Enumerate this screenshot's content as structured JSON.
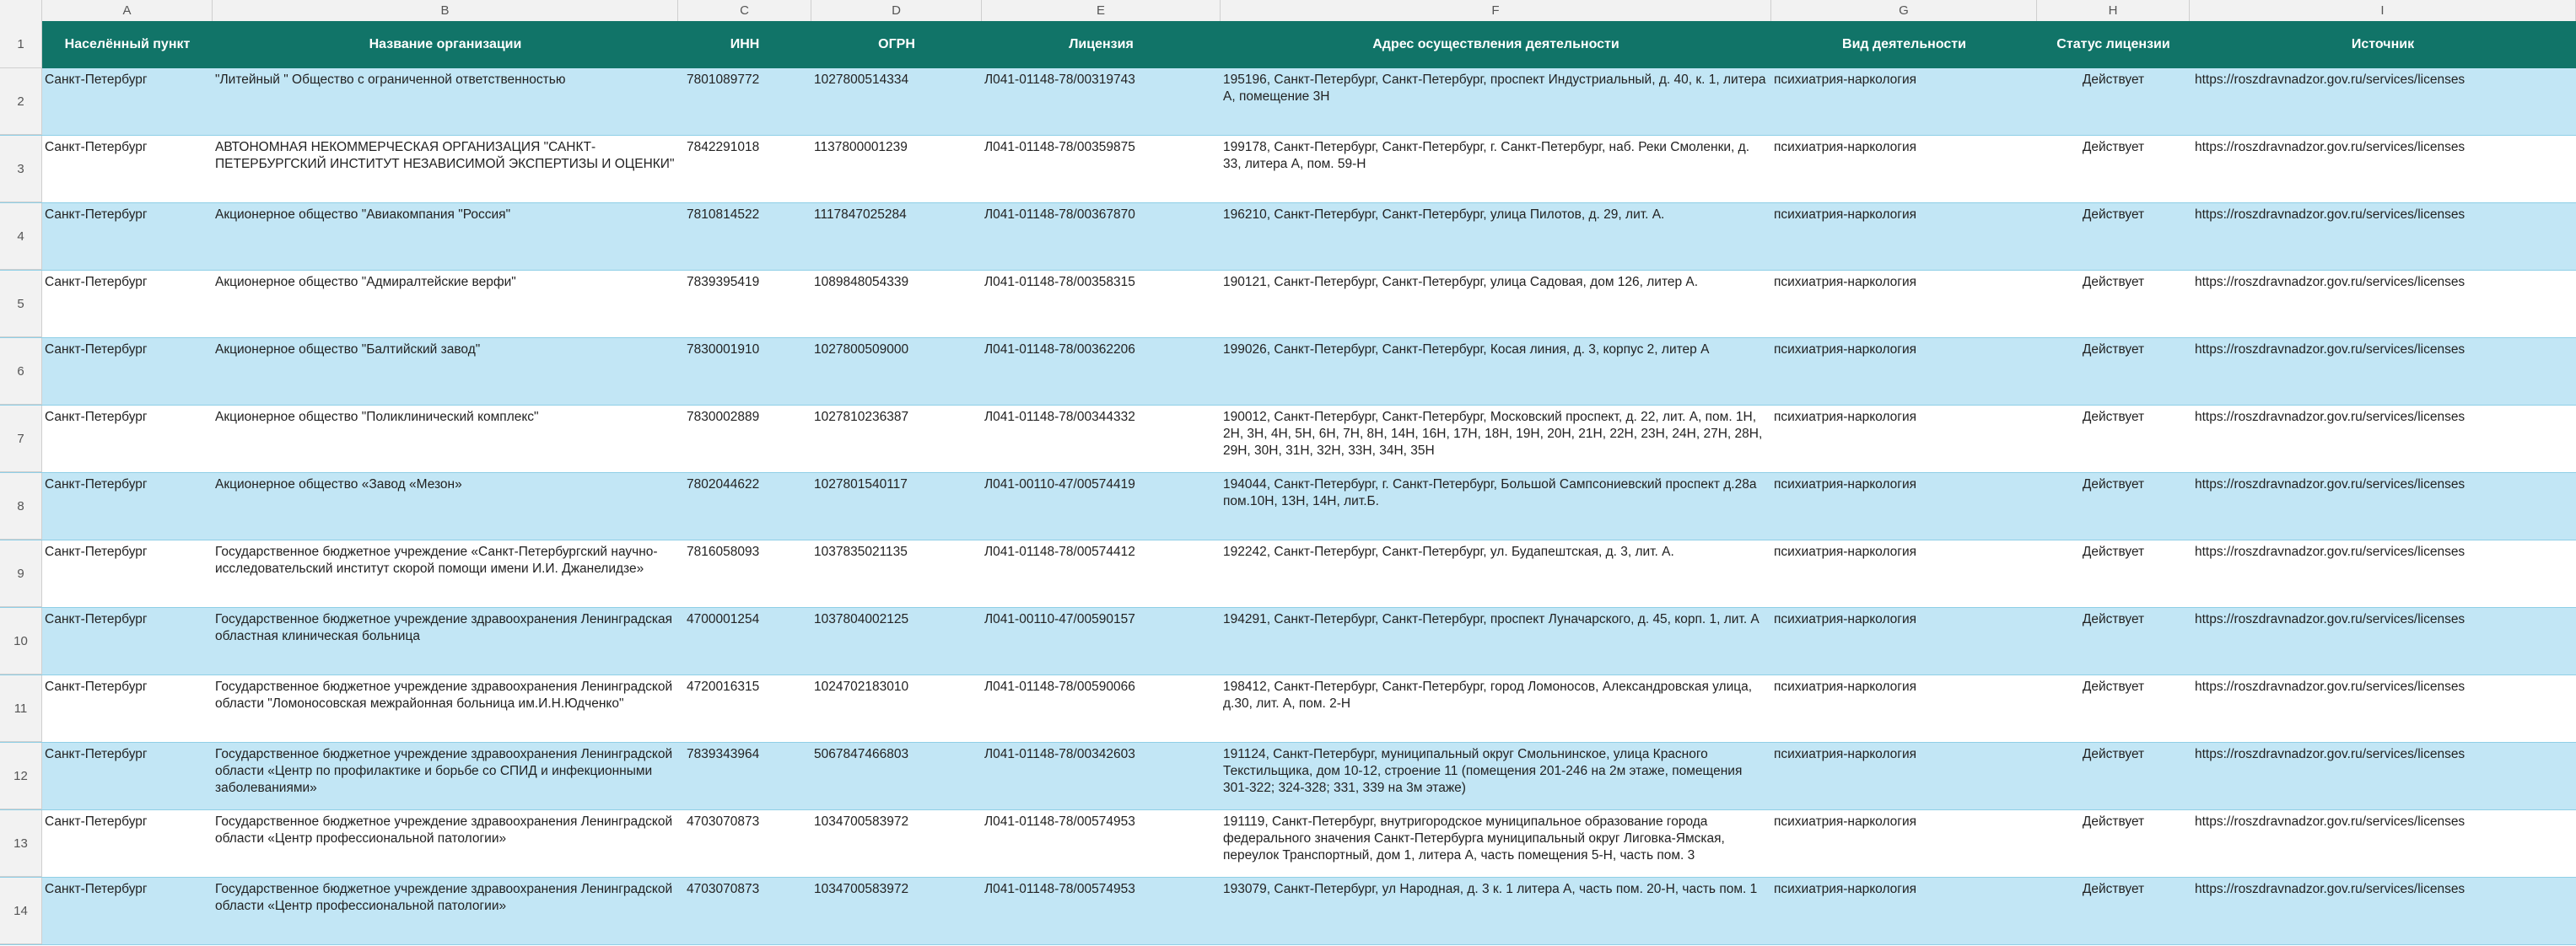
{
  "columns": [
    "A",
    "B",
    "C",
    "D",
    "E",
    "F",
    "G",
    "H",
    "I"
  ],
  "headers": [
    "Населённый пункт",
    "Название организации",
    "ИНН",
    "ОГРН",
    "Лицензия",
    "Адрес осуществления деятельности",
    "Вид деятельности",
    "Статус лицензии",
    "Источник"
  ],
  "row_numbers": [
    "1",
    "2",
    "3",
    "4",
    "5",
    "6",
    "7",
    "8",
    "9",
    "10",
    "11",
    "12",
    "13",
    "14"
  ],
  "rows": [
    [
      "Санкт-Петербург",
      "\"Литейный \" Общество с ограниченной ответственностью",
      "7801089772",
      "1027800514334",
      "Л041-01148-78/00319743",
      "195196, Санкт-Петербург, Санкт-Петербург, проспект Индустриальный, д. 40, к. 1, литера А, помещение 3Н",
      "психиатрия-наркология",
      "Действует",
      "https://roszdravnadzor.gov.ru/services/licenses"
    ],
    [
      "Санкт-Петербург",
      "АВТОНОМНАЯ НЕКОММЕРЧЕСКАЯ ОРГАНИЗАЦИЯ \"САНКТ-ПЕТЕРБУРГСКИЙ ИНСТИТУТ НЕЗАВИСИМОЙ ЭКСПЕРТИЗЫ И ОЦЕНКИ\"",
      "7842291018",
      "1137800001239",
      "Л041-01148-78/00359875",
      "199178, Санкт-Петербург, Санкт-Петербург, г. Санкт-Петербург, наб. Реки Смоленки, д. 33, литера А, пом. 59-Н",
      "психиатрия-наркология",
      "Действует",
      "https://roszdravnadzor.gov.ru/services/licenses"
    ],
    [
      "Санкт-Петербург",
      "Акционерное общество \"Авиакомпания \"Россия\"",
      "7810814522",
      "1117847025284",
      "Л041-01148-78/00367870",
      "196210, Санкт-Петербург, Санкт-Петербург, улица Пилотов, д. 29, лит. А.",
      "психиатрия-наркология",
      "Действует",
      "https://roszdravnadzor.gov.ru/services/licenses"
    ],
    [
      "Санкт-Петербург",
      "Акционерное общество \"Адмиралтейские верфи\"",
      "7839395419",
      "1089848054339",
      "Л041-01148-78/00358315",
      "190121, Санкт-Петербург, Санкт-Петербург, улица Садовая, дом 126, литер А.",
      "психиатрия-наркология",
      "Действует",
      "https://roszdravnadzor.gov.ru/services/licenses"
    ],
    [
      "Санкт-Петербург",
      "Акционерное общество \"Балтийский завод\"",
      "7830001910",
      "1027800509000",
      "Л041-01148-78/00362206",
      "199026, Санкт-Петербург, Санкт-Петербург, Косая линия, д. 3, корпус 2, литер А",
      "психиатрия-наркология",
      "Действует",
      "https://roszdravnadzor.gov.ru/services/licenses"
    ],
    [
      "Санкт-Петербург",
      "Акционерное общество \"Поликлинический комплекс\"",
      "7830002889",
      "1027810236387",
      "Л041-01148-78/00344332",
      "190012, Санкт-Петербург, Санкт-Петербург, Московский проспект, д. 22, лит. А, пом. 1Н, 2Н, 3Н, 4Н, 5Н, 6Н, 7Н, 8Н, 14Н, 16Н, 17Н, 18Н, 19Н, 20Н, 21Н, 22Н, 23Н, 24Н, 27Н, 28Н, 29Н, 30Н, 31Н, 32Н, 33Н, 34Н, 35Н",
      "психиатрия-наркология",
      "Действует",
      "https://roszdravnadzor.gov.ru/services/licenses"
    ],
    [
      "Санкт-Петербург",
      "Акционерное общество «Завод «Мезон»",
      "7802044622",
      "1027801540117",
      "Л041-00110-47/00574419",
      "194044, Санкт-Петербург, г. Санкт-Петербург, Большой Сампсониевский проспект д.28а пом.10Н, 13Н, 14Н, лит.Б.",
      "психиатрия-наркология",
      "Действует",
      "https://roszdravnadzor.gov.ru/services/licenses"
    ],
    [
      "Санкт-Петербург",
      "Государственное бюджетное учреждение «Санкт-Петербургский научно-исследовательский институт скорой помощи имени И.И. Джанелидзе»",
      "7816058093",
      "1037835021135",
      "Л041-01148-78/00574412",
      "192242, Санкт-Петербург, Санкт-Петербург, ул. Будапештская, д. 3, лит. А.",
      "психиатрия-наркология",
      "Действует",
      "https://roszdravnadzor.gov.ru/services/licenses"
    ],
    [
      "Санкт-Петербург",
      "Государственное бюджетное учреждение здравоохранения Ленинградская областная клиническая больница",
      "4700001254",
      "1037804002125",
      "Л041-00110-47/00590157",
      "194291, Санкт-Петербург, Санкт-Петербург, проспект Луначарского, д. 45, корп. 1, лит. А",
      "психиатрия-наркология",
      "Действует",
      "https://roszdravnadzor.gov.ru/services/licenses"
    ],
    [
      "Санкт-Петербург",
      "Государственное бюджетное учреждение здравоохранения Ленинградской области \"Ломоносовская межрайонная больница им.И.Н.Юдченко\"",
      "4720016315",
      "1024702183010",
      "Л041-01148-78/00590066",
      "198412, Санкт-Петербург, Санкт-Петербург, город Ломоносов, Александровская улица, д.30, лит. А, пом. 2-Н",
      "психиатрия-наркология",
      "Действует",
      "https://roszdravnadzor.gov.ru/services/licenses"
    ],
    [
      "Санкт-Петербург",
      "Государственное бюджетное учреждение здравоохранения Ленинградской области «Центр по профилактике и борьбе со СПИД и инфекционными заболеваниями»",
      "7839343964",
      "5067847466803",
      "Л041-01148-78/00342603",
      "191124, Санкт-Петербург, муниципальный округ Смольнинское, улица Красного Текстильщика, дом 10-12, строение 11 (помещения 201-246 на 2м этаже, помещения 301-322; 324-328; 331, 339 на 3м этаже)",
      "психиатрия-наркология",
      "Действует",
      "https://roszdravnadzor.gov.ru/services/licenses"
    ],
    [
      "Санкт-Петербург",
      "Государственное бюджетное учреждение здравоохранения Ленинградской области «Центр профессиональной патологии»",
      "4703070873",
      "1034700583972",
      "Л041-01148-78/00574953",
      "191119, Санкт-Петербург, внутригородское муниципальное образование города федерального значения Санкт-Петербурга муниципальный округ Лиговка-Ямская, переулок Транспортный, дом 1, литера А, часть помещения 5-Н, часть пом. 3",
      "психиатрия-наркология",
      "Действует",
      "https://roszdravnadzor.gov.ru/services/licenses"
    ],
    [
      "Санкт-Петербург",
      "Государственное бюджетное учреждение здравоохранения Ленинградской области «Центр профессиональной патологии»",
      "4703070873",
      "1034700583972",
      "Л041-01148-78/00574953",
      "193079, Санкт-Петербург, ул Народная, д. 3 к. 1 литера А, часть пом. 20-Н, часть пом. 1",
      "психиатрия-наркология",
      "Действует",
      "https://roszdravnadzor.gov.ru/services/licenses"
    ]
  ]
}
